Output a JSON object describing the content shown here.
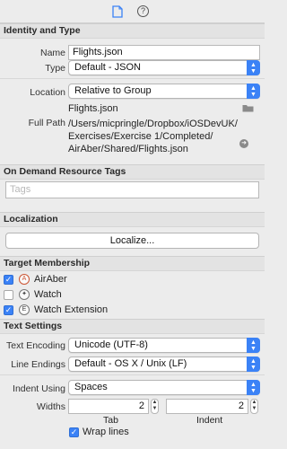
{
  "toolbar": {
    "file_inspector_icon": "file-icon",
    "help_icon_glyph": "?",
    "accent": "#3b82f6"
  },
  "identity": {
    "header": "Identity and Type",
    "name_label": "Name",
    "name_value": "Flights.json",
    "type_label": "Type",
    "type_value": "Default - JSON",
    "location_label": "Location",
    "location_value": "Relative to Group",
    "location_file": "Flights.json",
    "fullpath_label": "Full Path",
    "fullpath_line1": "/Users/micpringle/Dropbox/iOSDevUK/",
    "fullpath_line2": "Exercises/Exercise 1/Completed/",
    "fullpath_line3": "AirAber/Shared/Flights.json"
  },
  "odr": {
    "header": "On Demand Resource Tags",
    "tags_placeholder": "Tags"
  },
  "localization": {
    "header": "Localization",
    "button_label": "Localize..."
  },
  "target_membership": {
    "header": "Target Membership",
    "items": [
      {
        "label": "AirAber",
        "checked": true,
        "icon": "app-icon"
      },
      {
        "label": "Watch",
        "checked": false,
        "icon": "watch-app-icon"
      },
      {
        "label": "Watch Extension",
        "checked": true,
        "icon": "extension-icon"
      }
    ]
  },
  "text_settings": {
    "header": "Text Settings",
    "encoding_label": "Text Encoding",
    "encoding_value": "Unicode (UTF-8)",
    "line_endings_label": "Line Endings",
    "line_endings_value": "Default - OS X / Unix (LF)",
    "indent_label": "Indent Using",
    "indent_value": "Spaces",
    "widths_label": "Widths",
    "tab_value": "2",
    "tab_label": "Tab",
    "indent_width_value": "2",
    "indent_width_label": "Indent",
    "wrap_label": "Wrap lines",
    "wrap_checked": true
  }
}
